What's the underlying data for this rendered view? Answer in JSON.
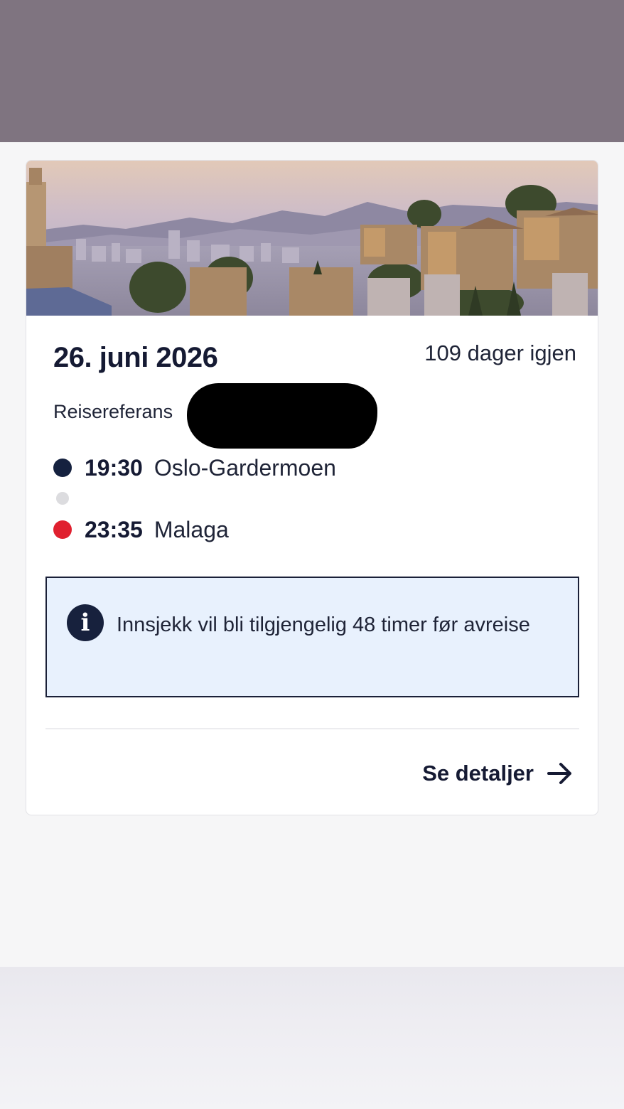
{
  "trip": {
    "date": "26. juni 2026",
    "countdown": "109 dager igjen",
    "reference_label": "Reisereferans"
  },
  "flight": {
    "departure": {
      "time": "19:30",
      "airport": "Oslo-Gardermoen",
      "dot_color": "#15213f"
    },
    "arrival": {
      "time": "23:35",
      "airport": "Malaga",
      "dot_color": "#e0202f"
    }
  },
  "info": {
    "icon": "info-icon",
    "message": "Innsjekk vil bli tilgjengelig 48 timer før avreise"
  },
  "actions": {
    "details_label": "Se detaljer",
    "details_icon": "arrow-right-icon"
  },
  "colors": {
    "top_band": "#7f7480",
    "info_background": "#e8f1fd",
    "primary_text": "#151a33",
    "accent_red": "#e0202f"
  }
}
